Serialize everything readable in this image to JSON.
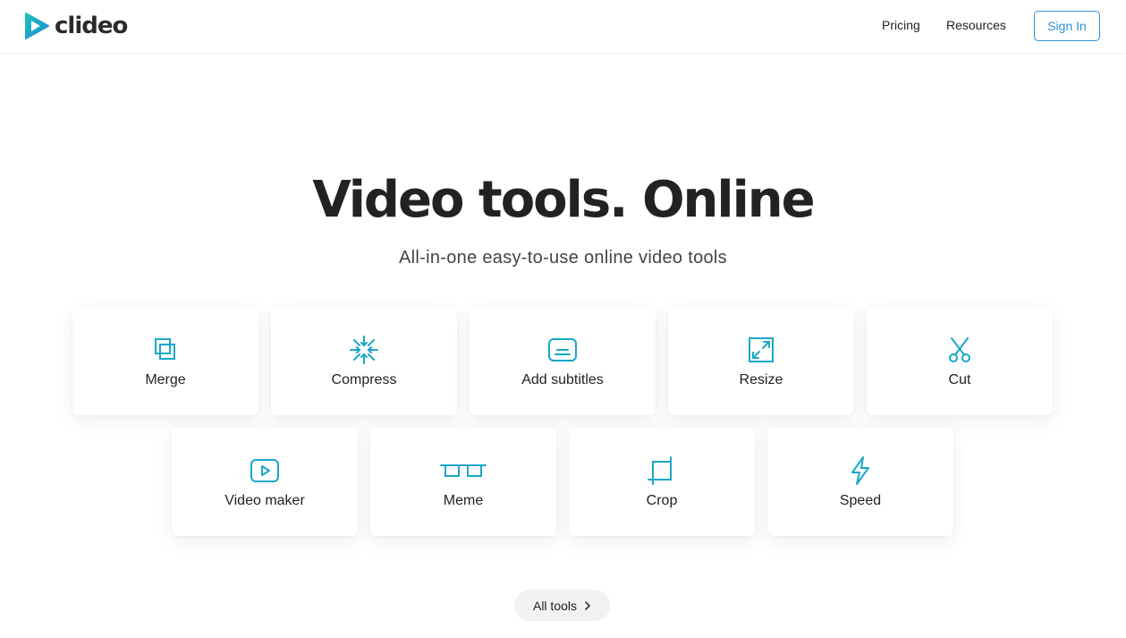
{
  "brand": {
    "name": "clideo",
    "colors": {
      "teal": "#1fc1b6",
      "blue": "#1e88d9",
      "accent_blue": "#2b8fd8",
      "icon": "#1aa7c9"
    }
  },
  "nav": {
    "pricing": "Pricing",
    "resources": "Resources",
    "sign_in": "Sign In"
  },
  "hero": {
    "title": "Video tools. Online",
    "subtitle": "All-in-one easy-to-use online video tools"
  },
  "tools": [
    {
      "label": "Merge",
      "icon": "merge-icon"
    },
    {
      "label": "Compress",
      "icon": "compress-icon"
    },
    {
      "label": "Add subtitles",
      "icon": "subtitles-icon"
    },
    {
      "label": "Resize",
      "icon": "resize-icon"
    },
    {
      "label": "Cut",
      "icon": "scissors-icon"
    },
    {
      "label": "Video maker",
      "icon": "play-icon"
    },
    {
      "label": "Meme",
      "icon": "glasses-icon"
    },
    {
      "label": "Crop",
      "icon": "crop-icon"
    },
    {
      "label": "Speed",
      "icon": "lightning-icon"
    }
  ],
  "all_tools": {
    "label": "All tools",
    "icon": "chevron-right-icon"
  }
}
